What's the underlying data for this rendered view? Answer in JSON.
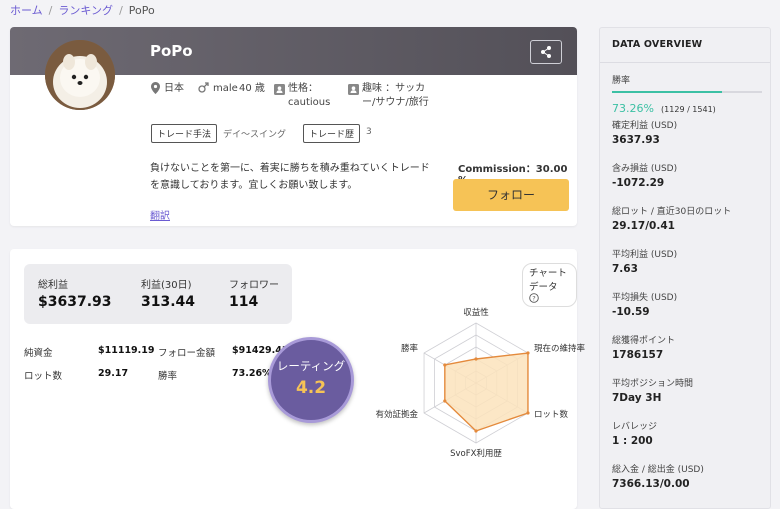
{
  "breadcrumb": {
    "home": "ホーム",
    "ranking": "ランキング",
    "current": "PoPo"
  },
  "profile": {
    "name": "PoPo",
    "country": "日本",
    "gender": "male",
    "age": "40 歳",
    "personality_label": "性格：",
    "personality_value": "cautious",
    "hobby": "趣味 ：サッカー/サウナ/旅行",
    "tag1_label": "トレード手法",
    "tag1_value": "デイ〜スイング",
    "tag2_label": "トレード歴",
    "tag2_value": "3",
    "description": "負けないことを第一に、着実に勝ちを積み重ねていくトレードを意識しております。宜しくお願い致します。",
    "translate_link": "翻訳",
    "commission": "Commission：30.00 %",
    "follow_button": "フォロー",
    "banner_color": "#5d5a62",
    "accent_color": "#f6c356"
  },
  "stats": {
    "total_profit_label": "総利益",
    "total_profit_value": "$3637.93",
    "profit30_label": "利益(30日)",
    "profit30_value": "313.44",
    "followers_label": "フォロワー",
    "followers_value": "114",
    "equity_label": "純資金",
    "equity_value": "$11119.19",
    "follower_amount_label": "フォロー金額",
    "follower_amount_value": "$91429.43",
    "lots_label": "ロット数",
    "lots_value": "29.17",
    "winrate_label": "勝率",
    "winrate_value": "73.26%",
    "chart_button": "チャートデータ",
    "rating_label": "レーティング",
    "rating_value": "4.2"
  },
  "chart_data": {
    "type": "radar",
    "axes": [
      "収益性",
      "現在の維持率",
      "ロット数",
      "SvoFX利用歴",
      "有効証拠金",
      "勝率"
    ],
    "values": [
      2,
      5,
      5,
      4,
      3,
      3
    ],
    "max": 5,
    "color": "#e48a3c"
  },
  "sidebar": {
    "title": "DATA OVERVIEW",
    "winrate_label": "勝率",
    "winrate_value": "73.26%",
    "winrate_detail": "(1129 / 1541)",
    "winrate_fraction": 0.7326,
    "winrate_color": "#3cc0a4",
    "items": [
      {
        "label": "確定利益 (USD)",
        "value": "3637.93"
      },
      {
        "label": "含み損益 (USD)",
        "value": "-1072.29"
      },
      {
        "label": "総ロット / 直近30日のロット",
        "value": "29.17/0.41"
      },
      {
        "label": "平均利益 (USD)",
        "value": "7.63"
      },
      {
        "label": "平均損失 (USD)",
        "value": "-10.59"
      },
      {
        "label": "総獲得ポイント",
        "value": "1786157"
      },
      {
        "label": "平均ポジション時間",
        "value": "7Day 3H"
      },
      {
        "label": "レバレッジ",
        "value": "1 : 200"
      },
      {
        "label": "総入金 / 総出金 (USD)",
        "value": "7366.13/0.00"
      }
    ]
  }
}
